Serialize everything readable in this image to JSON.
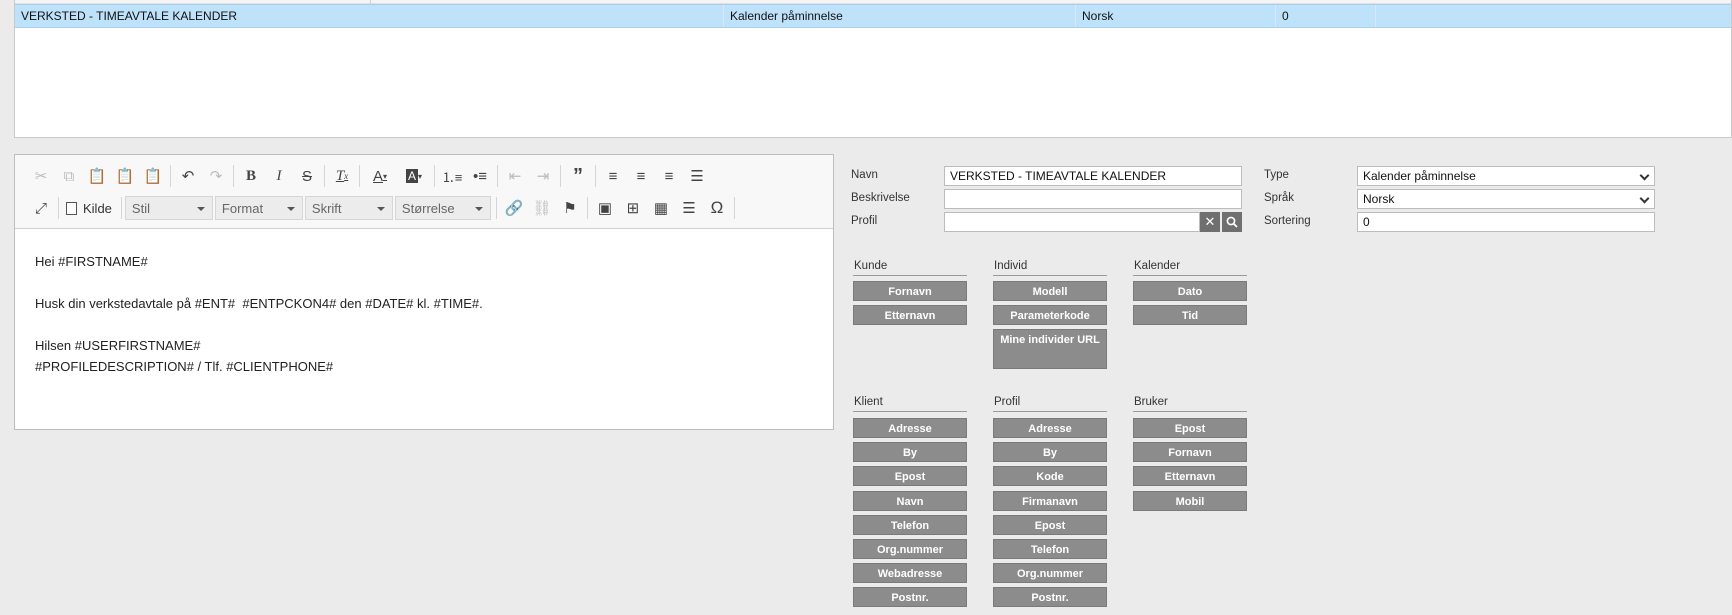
{
  "grid": {
    "row": {
      "name": "VERKSTED - TIMEAVTALE KALENDER",
      "type": "Kalender påminnelse",
      "language": "Norsk",
      "sorting": "0"
    }
  },
  "editor": {
    "toolbar": {
      "source_label": "Kilde",
      "style_label": "Stil",
      "format_label": "Format",
      "font_label": "Skrift",
      "size_label": "Størrelse"
    },
    "content": {
      "line1": "Hei #FIRSTNAME#",
      "line2": "Husk din verkstedavtale på #ENT#  #ENTPCKON4# den #DATE# kl. #TIME#.",
      "line3": "Hilsen #USERFIRSTNAME#",
      "line4": "#PROFILEDESCRIPTION# / Tlf. #CLIENTPHONE#"
    }
  },
  "form": {
    "name_label": "Navn",
    "name_value": "VERKSTED - TIMEAVTALE KALENDER",
    "description_label": "Beskrivelse",
    "description_value": "",
    "profile_label": "Profil",
    "profile_value": "",
    "type_label": "Type",
    "type_value": "Kalender påminnelse",
    "language_label": "Språk",
    "language_value": "Norsk",
    "sorting_label": "Sortering",
    "sorting_value": "0"
  },
  "merge": {
    "kunde": {
      "title": "Kunde",
      "buttons": [
        "Fornavn",
        "Etternavn"
      ]
    },
    "individ": {
      "title": "Individ",
      "buttons": [
        "Modell",
        "Parameterkode",
        "Mine individer URL"
      ]
    },
    "kalender": {
      "title": "Kalender",
      "buttons": [
        "Dato",
        "Tid"
      ]
    },
    "klient": {
      "title": "Klient",
      "buttons": [
        "Adresse",
        "By",
        "Epost",
        "Navn",
        "Telefon",
        "Org.nummer",
        "Webadresse",
        "Postnr."
      ]
    },
    "profil": {
      "title": "Profil",
      "buttons": [
        "Adresse",
        "By",
        "Kode",
        "Firmanavn",
        "Epost",
        "Telefon",
        "Org.nummer",
        "Postnr."
      ]
    },
    "bruker": {
      "title": "Bruker",
      "buttons": [
        "Epost",
        "Fornavn",
        "Etternavn",
        "Mobil"
      ]
    }
  }
}
